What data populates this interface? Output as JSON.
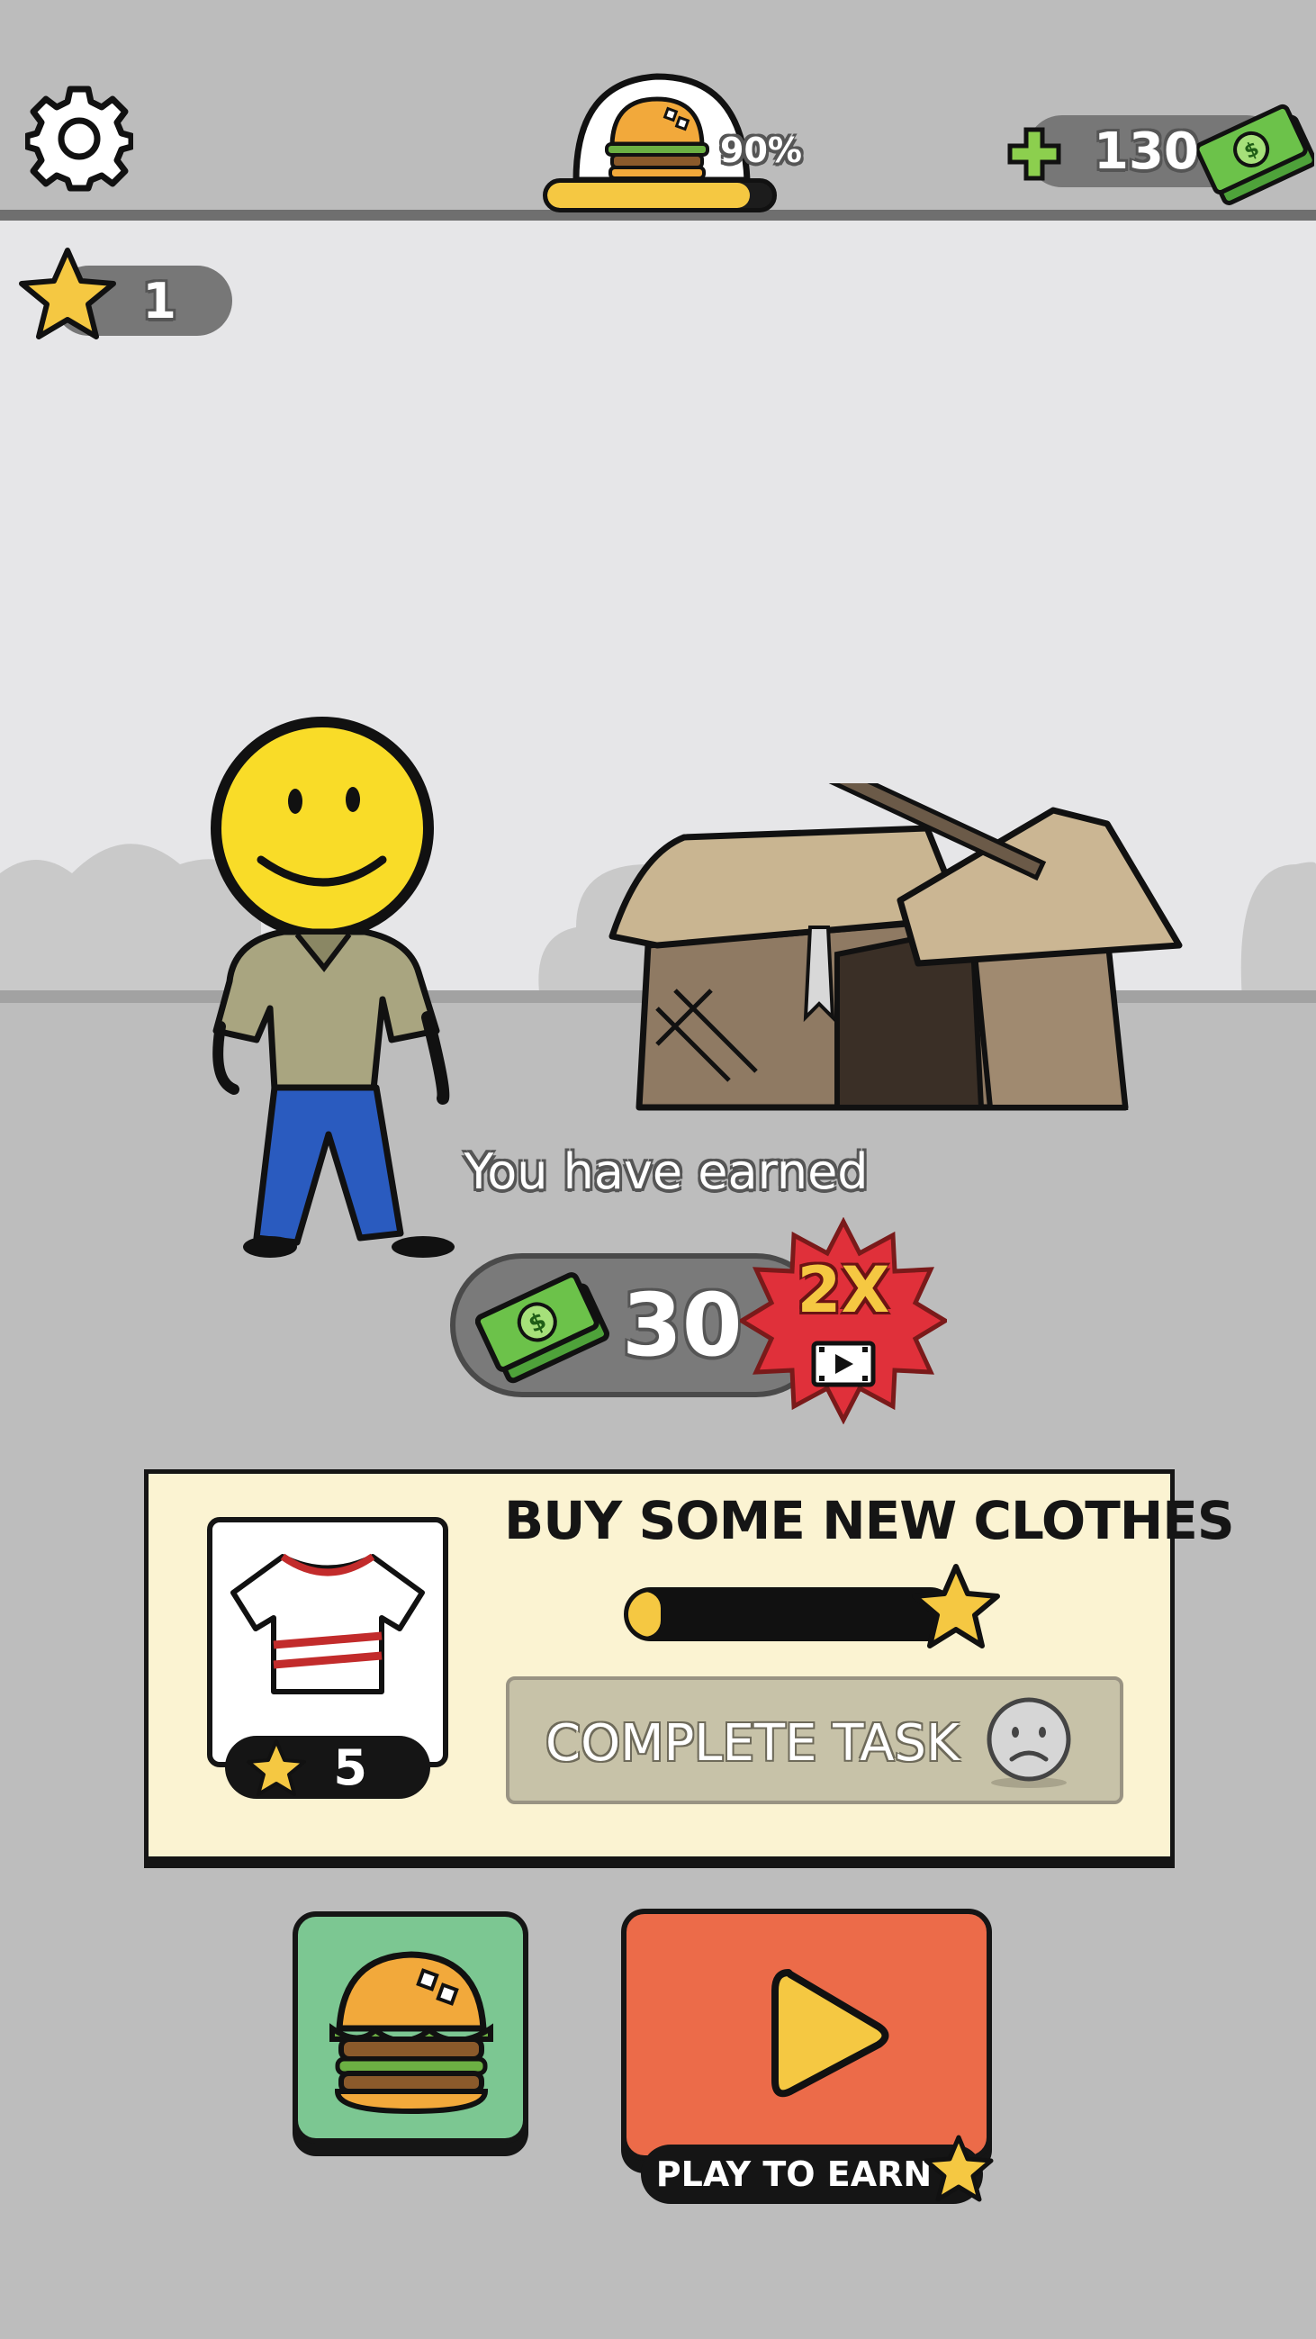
{
  "hud": {
    "hunger_percent_label": "90%",
    "hunger_level": 0.9,
    "money": "130",
    "stars": "1"
  },
  "reward": {
    "earned_label": "You have earned",
    "amount": "30",
    "multiplier": "2X"
  },
  "task": {
    "title": "BUY SOME NEW CLOTHES",
    "progress": 0.1,
    "complete_label": "COMPLETE TASK",
    "cost_stars": "5"
  },
  "actions": {
    "play_label": "PLAY TO EARN"
  },
  "colors": {
    "accent_yellow": "#f5c842",
    "food_button": "#7cc792",
    "play_button": "#ec6b49",
    "money_green": "#5fb845",
    "badge_red": "#e0303a"
  }
}
